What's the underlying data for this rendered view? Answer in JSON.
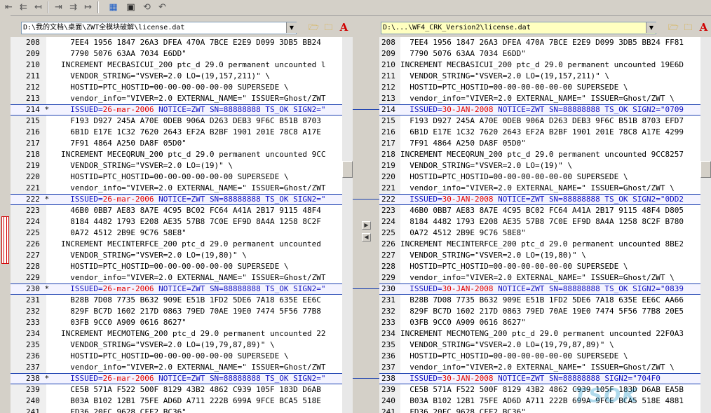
{
  "toolbar": {
    "icons": [
      "copy-left-icon",
      "copy-left-all-icon",
      "copy-left-lines-icon",
      "copy-right-icon",
      "copy-right-all-icon",
      "copy-right-lines-icon",
      "compare-icon",
      "save-icon",
      "recompare-icon",
      "undo-icon"
    ]
  },
  "left": {
    "path": "D:\\我的文档\\桌面\\ZWT全模块破解\\license.dat",
    "lines": [
      {
        "n": "208",
        "mark": "",
        "t": "  7EE4 1956 1847 26A3 DFEA 470A 7BCE E2E9 D099 3DB5 BB24"
      },
      {
        "n": "209",
        "mark": "",
        "t": "  7790 5076 63AA 7034 E6DD\""
      },
      {
        "n": "210",
        "mark": "",
        "t": "INCREMENT MECBASICUI_200 ptc_d 29.0 permanent uncounted l"
      },
      {
        "n": "211",
        "mark": "",
        "t": "  VENDOR_STRING=\"VSVER=2.0 LO=(19,157,211)\" \\"
      },
      {
        "n": "212",
        "mark": "",
        "t": "  HOSTID=PTC_HOSTID=00-00-00-00-00-00 SUPERSEDE \\"
      },
      {
        "n": "213",
        "mark": "",
        "t": "  vendor_info=\"VIVER=2.0 EXTERNAL_NAME=\" ISSUER=Ghost/ZWT"
      },
      {
        "n": "214",
        "mark": "*",
        "diff": true,
        "a": "  ISSUED=",
        "b": "26-mar-2006",
        "c": " NOTICE=ZWT SN=88888888 TS_OK SIGN2=\""
      },
      {
        "n": "215",
        "mark": "",
        "t": "  F193 D927 245A A70E 0DEB 906A D263 DEB3 9F6C B51B 8703"
      },
      {
        "n": "216",
        "mark": "",
        "t": "  6B1D E17E 1C32 7620 2643 EF2A B2BF 1901 201E 78C8 A17E"
      },
      {
        "n": "217",
        "mark": "",
        "t": "  7F91 4864 A250 DA8F 05D0\""
      },
      {
        "n": "218",
        "mark": "",
        "t": "INCREMENT MECEQRUN_200 ptc_d 29.0 permanent uncounted 9CC"
      },
      {
        "n": "219",
        "mark": "",
        "t": "  VENDOR_STRING=\"VSVER=2.0 LO=(19)\" \\"
      },
      {
        "n": "220",
        "mark": "",
        "t": "  HOSTID=PTC_HOSTID=00-00-00-00-00-00 SUPERSEDE \\"
      },
      {
        "n": "221",
        "mark": "",
        "t": "  vendor_info=\"VIVER=2.0 EXTERNAL_NAME=\" ISSUER=Ghost/ZWT"
      },
      {
        "n": "222",
        "mark": "*",
        "diff": true,
        "a": "  ISSUED=",
        "b": "26-mar-2006",
        "c": " NOTICE=ZWT SN=88888888 TS_OK SIGN2=\""
      },
      {
        "n": "223",
        "mark": "",
        "t": "  46B0 0BB7 AE83 8A7E 4C95 BC02 FC64 A41A 2B17 9115 48F4"
      },
      {
        "n": "224",
        "mark": "",
        "t": "  8184 4482 1793 E208 AE35 57B8 7C0E EF9D 8A4A 1258 8C2F"
      },
      {
        "n": "225",
        "mark": "",
        "t": "  0A72 4512 2B9E 9C76 58E8\""
      },
      {
        "n": "226",
        "mark": "",
        "t": "INCREMENT MECINTERFCE_200 ptc_d 29.0 permanent uncounted"
      },
      {
        "n": "227",
        "mark": "",
        "t": "  VENDOR_STRING=\"VSVER=2.0 LO=(19,80)\" \\"
      },
      {
        "n": "228",
        "mark": "",
        "t": "  HOSTID=PTC_HOSTID=00-00-00-00-00-00 SUPERSEDE \\"
      },
      {
        "n": "229",
        "mark": "",
        "t": "  vendor_info=\"VIVER=2.0 EXTERNAL_NAME=\" ISSUER=Ghost/ZWT"
      },
      {
        "n": "230",
        "mark": "*",
        "diff": true,
        "a": "  ISSUED=",
        "b": "26-mar-2006",
        "c": " NOTICE=ZWT SN=88888888 TS_OK SIGN2=\""
      },
      {
        "n": "231",
        "mark": "",
        "t": "  B28B 7D08 7735 B632 909E E51B 1FD2 5DE6 7A18 635E EE6C"
      },
      {
        "n": "232",
        "mark": "",
        "t": "  829F BC7D 1602 217D 0863 79ED 70AE 19E0 7474 5F56 77B8"
      },
      {
        "n": "233",
        "mark": "",
        "t": "  03FB 9CC0 A909 0616 8627\""
      },
      {
        "n": "234",
        "mark": "",
        "t": "INCREMENT MECMOTENG_200 ptc_d 29.0 permanent uncounted 22"
      },
      {
        "n": "235",
        "mark": "",
        "t": "  VENDOR_STRING=\"VSVER=2.0 LO=(19,79,87,89)\" \\"
      },
      {
        "n": "236",
        "mark": "",
        "t": "  HOSTID=PTC_HOSTID=00-00-00-00-00-00 SUPERSEDE \\"
      },
      {
        "n": "237",
        "mark": "",
        "t": "  vendor_info=\"VIVER=2.0 EXTERNAL_NAME=\" ISSUER=Ghost/ZWT"
      },
      {
        "n": "238",
        "mark": "*",
        "diff": true,
        "a": "  ISSUED=",
        "b": "26-mar-2006",
        "c": " NOTICE=ZWT SN=88888888 TS_OK SIGN2=\""
      },
      {
        "n": "239",
        "mark": "",
        "t": "  CE5B 571A F522 500F 8129 43B2 4862 C939 105F 183D D6AB"
      },
      {
        "n": "240",
        "mark": "",
        "t": "  B03A B102 12B1 75FE AD6D A711 222B 699A 9FCE BCA5 518E"
      },
      {
        "n": "241",
        "mark": "",
        "t": "  FD36 20FC 9628 CFF2 BC36\""
      }
    ]
  },
  "right": {
    "path": "D:\\...\\WF4_CRK_Version2\\license.dat",
    "lines": [
      {
        "n": "208",
        "t": "  7EE4 1956 1847 26A3 DFEA 470A 7BCE E2E9 D099 3DB5 BB24 FF81"
      },
      {
        "n": "209",
        "t": "  7790 5076 63AA 7034 E6DD\""
      },
      {
        "n": "210",
        "t": "INCREMENT MECBASICUI_200 ptc_d 29.0 permanent uncounted 19E6D"
      },
      {
        "n": "211",
        "t": "  VENDOR_STRING=\"VSVER=2.0 LO=(19,157,211)\" \\"
      },
      {
        "n": "212",
        "t": "  HOSTID=PTC_HOSTID=00-00-00-00-00-00 SUPERSEDE \\"
      },
      {
        "n": "213",
        "t": "  vendor_info=\"VIVER=2.0 EXTERNAL_NAME=\" ISSUER=Ghost/ZWT \\"
      },
      {
        "n": "214",
        "diff": true,
        "a": "  ISSUED=",
        "b": "30-JAN-2008",
        "c": " NOTICE=ZWT SN=88888888 TS_OK SIGN2=\"0709"
      },
      {
        "n": "215",
        "t": "  F193 D927 245A A70E 0DEB 906A D263 DEB3 9F6C B51B 8703 EFD7"
      },
      {
        "n": "216",
        "t": "  6B1D E17E 1C32 7620 2643 EF2A B2BF 1901 201E 78C8 A17E 4299"
      },
      {
        "n": "217",
        "t": "  7F91 4864 A250 DA8F 05D0\""
      },
      {
        "n": "218",
        "t": "INCREMENT MECEQRUN_200 ptc_d 29.0 permanent uncounted 9CC8257"
      },
      {
        "n": "219",
        "t": "  VENDOR_STRING=\"VSVER=2.0 LO=(19)\" \\"
      },
      {
        "n": "220",
        "t": "  HOSTID=PTC_HOSTID=00-00-00-00-00-00 SUPERSEDE \\"
      },
      {
        "n": "221",
        "t": "  vendor_info=\"VIVER=2.0 EXTERNAL_NAME=\" ISSUER=Ghost/ZWT \\"
      },
      {
        "n": "222",
        "diff": true,
        "a": "  ISSUED=",
        "b": "30-JAN-2008",
        "c": " NOTICE=ZWT SN=88888888 TS_OK SIGN2=\"0DD2"
      },
      {
        "n": "223",
        "t": "  46B0 0BB7 AE83 8A7E 4C95 BC02 FC64 A41A 2B17 9115 48F4 D805"
      },
      {
        "n": "224",
        "t": "  8184 4482 1793 E208 AE35 57B8 7C0E EF9D 8A4A 1258 8C2F B780"
      },
      {
        "n": "225",
        "t": "  0A72 4512 2B9E 9C76 58E8\""
      },
      {
        "n": "226",
        "t": "INCREMENT MECINTERFCE_200 ptc_d 29.0 permanent uncounted 8BE2"
      },
      {
        "n": "227",
        "t": "  VENDOR_STRING=\"VSVER=2.0 LO=(19,80)\" \\"
      },
      {
        "n": "228",
        "t": "  HOSTID=PTC_HOSTID=00-00-00-00-00-00 SUPERSEDE \\"
      },
      {
        "n": "229",
        "t": "  vendor_info=\"VIVER=2.0 EXTERNAL_NAME=\" ISSUER=Ghost/ZWT \\"
      },
      {
        "n": "230",
        "diff": true,
        "a": "  ISSUED=",
        "b": "30-JAN-2008",
        "c": " NOTICE=ZWT SN=88888888 TS_OK SIGN2=\"0839"
      },
      {
        "n": "231",
        "t": "  B28B 7D08 7735 B632 909E E51B 1FD2 5DE6 7A18 635E EE6C AA66"
      },
      {
        "n": "232",
        "t": "  829F BC7D 1602 217D 0863 79ED 70AE 19E0 7474 5F56 77B8 20E5"
      },
      {
        "n": "233",
        "t": "  03FB 9CC0 A909 0616 8627\""
      },
      {
        "n": "234",
        "t": "INCREMENT MECMOTENG_200 ptc_d 29.0 permanent uncounted 22F0A3"
      },
      {
        "n": "235",
        "t": "  VENDOR_STRING=\"VSVER=2.0 LO=(19,79,87,89)\" \\"
      },
      {
        "n": "236",
        "t": "  HOSTID=PTC_HOSTID=00-00-00-00-00-00 SUPERSEDE \\"
      },
      {
        "n": "237",
        "t": "  vendor_info=\"VIVER=2.0 EXTERNAL_NAME=\" ISSUER=Ghost/ZWT \\"
      },
      {
        "n": "238",
        "diff": true,
        "a": "  ISSUED=",
        "b": "30-JAN-2008",
        "c": " NOTICE=ZWT SN=88888888 SIGN2=\"704F0"
      },
      {
        "n": "239",
        "t": "  CE5B 571A F522 500F 8129 43B2 4862 C939 105F 183D D6AB EA5B"
      },
      {
        "n": "240",
        "t": "  B03A B102 12B1 75FE AD6D A711 222B 699A 9FCE BCA5 518E 4881"
      },
      {
        "n": "241",
        "t": "  FD36 20FC 9628 CFF2 BC36\""
      }
    ]
  },
  "colors": {
    "diff_text": "#1010c0",
    "changed_date": "#e00000",
    "diff_border": "#1a3fb0"
  }
}
